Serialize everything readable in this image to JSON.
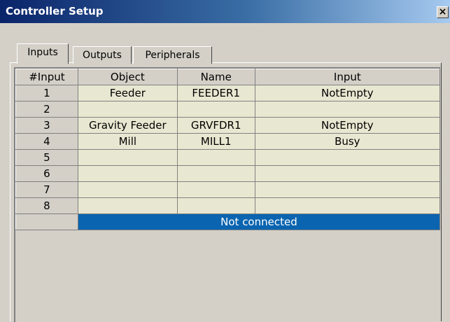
{
  "window": {
    "title": "Controller Setup",
    "close_label": "×"
  },
  "tabs": [
    {
      "label": "Inputs"
    },
    {
      "label": "Outputs"
    },
    {
      "label": "Peripherals"
    }
  ],
  "table": {
    "headers": [
      "#Input",
      "Object",
      "Name",
      "Input"
    ],
    "rows": [
      [
        "1",
        "Feeder",
        "FEEDER1",
        "NotEmpty"
      ],
      [
        "2",
        "",
        "",
        ""
      ],
      [
        "3",
        "Gravity Feeder",
        "GRVFDR1",
        "NotEmpty"
      ],
      [
        "4",
        "Mill",
        "MILL1",
        "Busy"
      ],
      [
        "5",
        "",
        "",
        ""
      ],
      [
        "6",
        "",
        "",
        ""
      ],
      [
        "7",
        "",
        "",
        ""
      ],
      [
        "8",
        "",
        "",
        ""
      ]
    ],
    "status_text": "Not connected"
  },
  "colors": {
    "status_bg": "#0a64b0",
    "cell_bg": "#e8e8d2",
    "face": "#d4d0c8"
  }
}
